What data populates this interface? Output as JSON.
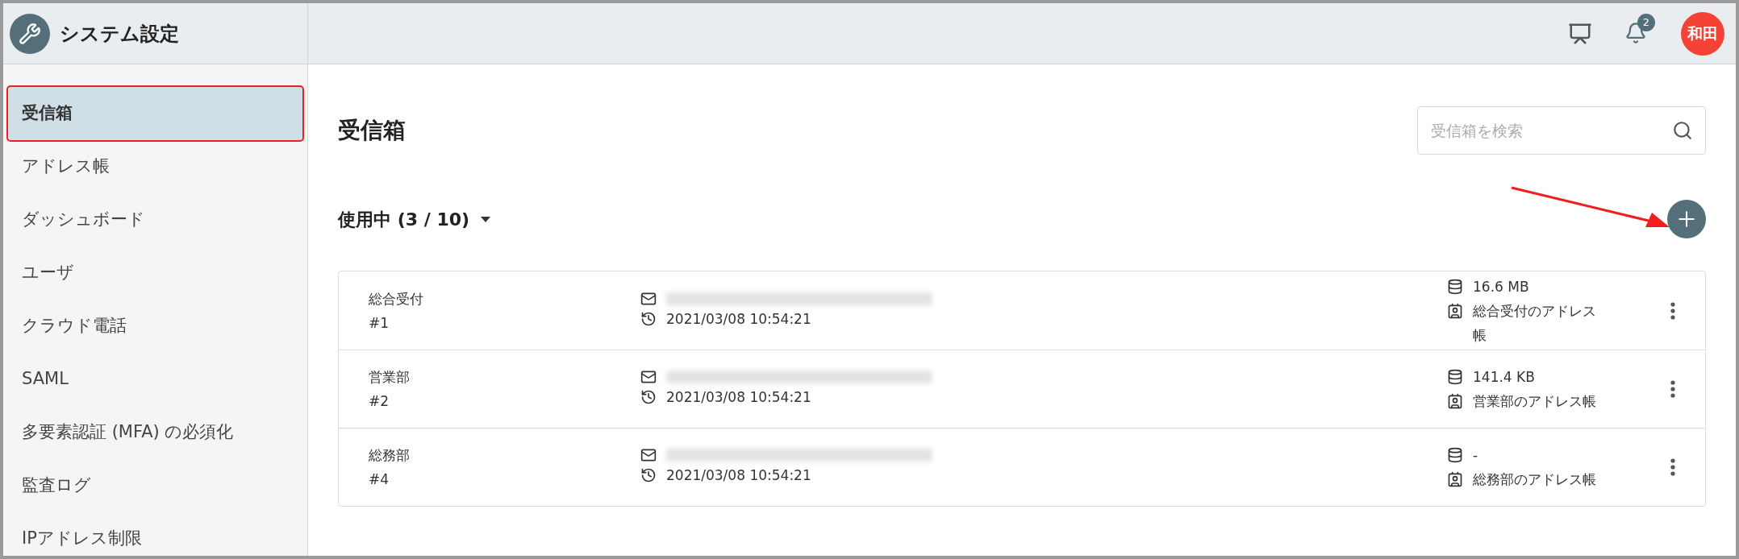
{
  "app": {
    "title": "システム設定",
    "notification_count": "2",
    "avatar": "和田"
  },
  "sidebar": {
    "items": [
      {
        "label": "受信箱",
        "selected": true
      },
      {
        "label": "アドレス帳",
        "selected": false
      },
      {
        "label": "ダッシュボード",
        "selected": false
      },
      {
        "label": "ユーザ",
        "selected": false
      },
      {
        "label": "クラウド電話",
        "selected": false
      },
      {
        "label": "SAML",
        "selected": false
      },
      {
        "label": "多要素認証 (MFA) の必須化",
        "selected": false
      },
      {
        "label": "監査ログ",
        "selected": false
      },
      {
        "label": "IPアドレス制限",
        "selected": false
      }
    ]
  },
  "page": {
    "title": "受信箱",
    "search": {
      "placeholder": "受信箱を検索"
    },
    "section": "使用中 (3 / 10)"
  },
  "inboxes": [
    {
      "name": "総合受付",
      "number": "#1",
      "updated": "2021/03/08 10:54:21",
      "size": "16.6 MB",
      "address_book": "総合受付のアドレス帳"
    },
    {
      "name": "営業部",
      "number": "#2",
      "updated": "2021/03/08 10:54:21",
      "size": "141.4 KB",
      "address_book": "営業部のアドレス帳"
    },
    {
      "name": "総務部",
      "number": "#4",
      "updated": "2021/03/08 10:54:21",
      "size": "-",
      "address_book": "総務部のアドレス帳"
    }
  ]
}
